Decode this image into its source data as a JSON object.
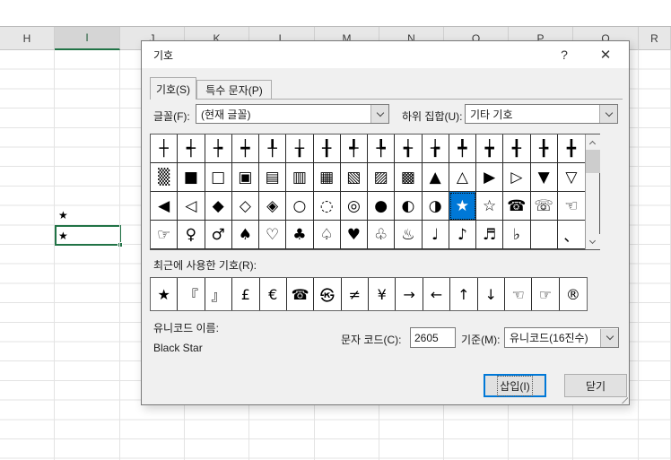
{
  "excel": {
    "column_headers": [
      "H",
      "I",
      "J",
      "K",
      "L",
      "M",
      "N",
      "O",
      "P",
      "Q",
      "R"
    ],
    "selected_column": "I",
    "cell_above_value": "★",
    "selected_cell_value": "★",
    "selection_color": "#217346"
  },
  "dialog": {
    "title": "기호",
    "help_icon": "?",
    "close_icon": "✕",
    "tabs": [
      {
        "label": "기호(S)",
        "active": true
      },
      {
        "label": "특수 문자(P)",
        "active": false
      }
    ],
    "font_label": "글꼴(F):",
    "font_value": "(현재 글꼴)",
    "subset_label": "하위 집합(U):",
    "subset_value": "기타 기호",
    "grid": {
      "rows": [
        [
          "┼",
          "┽",
          "┾",
          "┿",
          "╀",
          "╁",
          "╂",
          "╃",
          "╄",
          "╅",
          "╆",
          "╇",
          "╈",
          "╉",
          "╊",
          "╋"
        ],
        [
          "▒",
          "■",
          "□",
          "▣",
          "▤",
          "▥",
          "▦",
          "▧",
          "▨",
          "▩",
          "▲",
          "△",
          "▶",
          "▷",
          "▼",
          "▽"
        ],
        [
          "◀",
          "◁",
          "◆",
          "◇",
          "◈",
          "○",
          "◌",
          "◎",
          "●",
          "◐",
          "◑",
          "★",
          "☆",
          "☎",
          "☏",
          "☜"
        ],
        [
          "☞",
          "♀",
          "♂",
          "♠",
          "♡",
          "♣",
          "♤",
          "♥",
          "♧",
          "♨",
          "♩",
          "♪",
          "♬",
          "♭",
          "",
          "、"
        ]
      ],
      "selected": {
        "row": 2,
        "col": 11,
        "symbol": "★"
      }
    },
    "recent_label": "최근에 사용한 기호(R):",
    "recent_symbols": [
      "★",
      "『",
      "』",
      "£",
      "€",
      "☎",
      "㉿",
      "≠",
      "¥",
      "→",
      "←",
      "↑",
      "↓",
      "☜",
      "☞",
      "®"
    ],
    "unicode_name_label": "유니코드 이름:",
    "unicode_name_value": "Black Star",
    "char_code_label": "문자 코드(C):",
    "char_code_value": "2605",
    "from_label": "기준(M):",
    "from_value": "유니코드(16진수)",
    "insert_button": "삽입(I)",
    "close_button": "닫기",
    "accent_color": "#0078D7"
  }
}
